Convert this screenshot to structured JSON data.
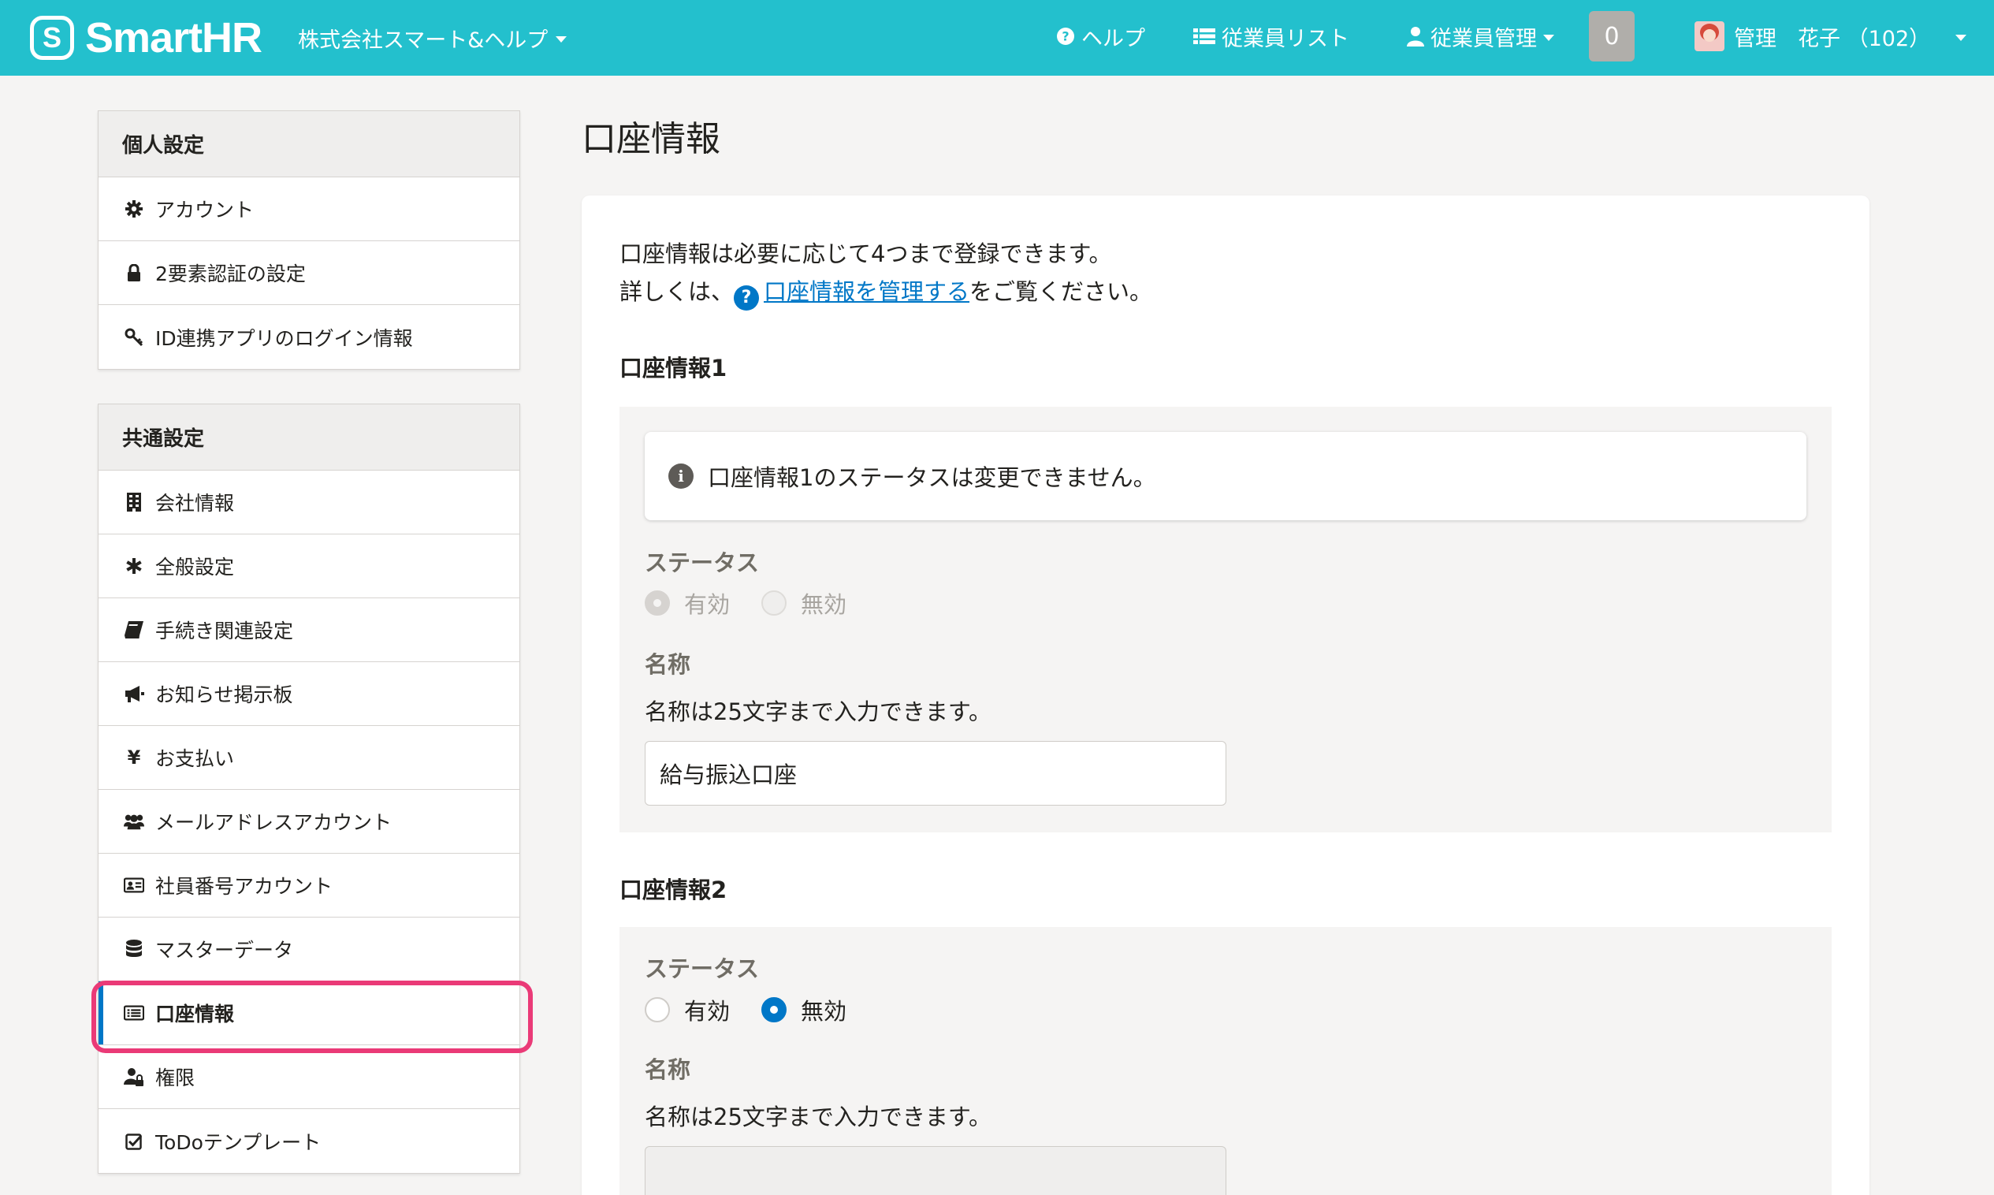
{
  "header": {
    "logo_text": "SmartHR",
    "company": "株式会社スマート&ヘルプ",
    "help": "ヘルプ",
    "employee_list": "従業員リスト",
    "employee_manage": "従業員管理",
    "notification_count": "0",
    "user_name": "管理　花子 （102）"
  },
  "sidebar": {
    "personal_title": "個人設定",
    "personal_items": [
      {
        "label": "アカウント",
        "icon": "gear-icon"
      },
      {
        "label": "2要素認証の設定",
        "icon": "lock-icon"
      },
      {
        "label": "ID連携アプリのログイン情報",
        "icon": "key-icon"
      }
    ],
    "common_title": "共通設定",
    "common_items": [
      {
        "label": "会社情報",
        "icon": "building-icon"
      },
      {
        "label": "全般設定",
        "icon": "asterisk-icon"
      },
      {
        "label": "手続き関連設定",
        "icon": "book-icon"
      },
      {
        "label": "お知らせ掲示板",
        "icon": "megaphone-icon"
      },
      {
        "label": "お支払い",
        "icon": "yen-icon"
      },
      {
        "label": "メールアドレスアカウント",
        "icon": "users-icon"
      },
      {
        "label": "社員番号アカウント",
        "icon": "id-card-icon"
      },
      {
        "label": "マスターデータ",
        "icon": "database-icon"
      },
      {
        "label": "口座情報",
        "icon": "list-alt-icon"
      },
      {
        "label": "権限",
        "icon": "user-lock-icon"
      },
      {
        "label": "ToDoテンプレート",
        "icon": "check-square-icon"
      }
    ]
  },
  "main": {
    "title": "口座情報",
    "intro_line1": "口座情報は必要に応じて4つまで登録できます。",
    "intro_prefix": "詳しくは、",
    "intro_link": "口座情報を管理する",
    "intro_suffix": "をご覧ください。",
    "account1": {
      "title": "口座情報1",
      "notice": "口座情報1のステータスは変更できません。",
      "status_label": "ステータス",
      "option_enabled": "有効",
      "option_disabled": "無効",
      "name_label": "名称",
      "name_help": "名称は25文字まで入力できます。",
      "name_value": "給与振込口座"
    },
    "account2": {
      "title": "口座情報2",
      "status_label": "ステータス",
      "option_enabled": "有効",
      "option_disabled": "無効",
      "name_label": "名称",
      "name_help": "名称は25文字まで入力できます。",
      "name_value": ""
    }
  },
  "colors": {
    "header_bg": "#23c0cd",
    "link": "#0077c7",
    "highlight": "#ea3a77"
  }
}
